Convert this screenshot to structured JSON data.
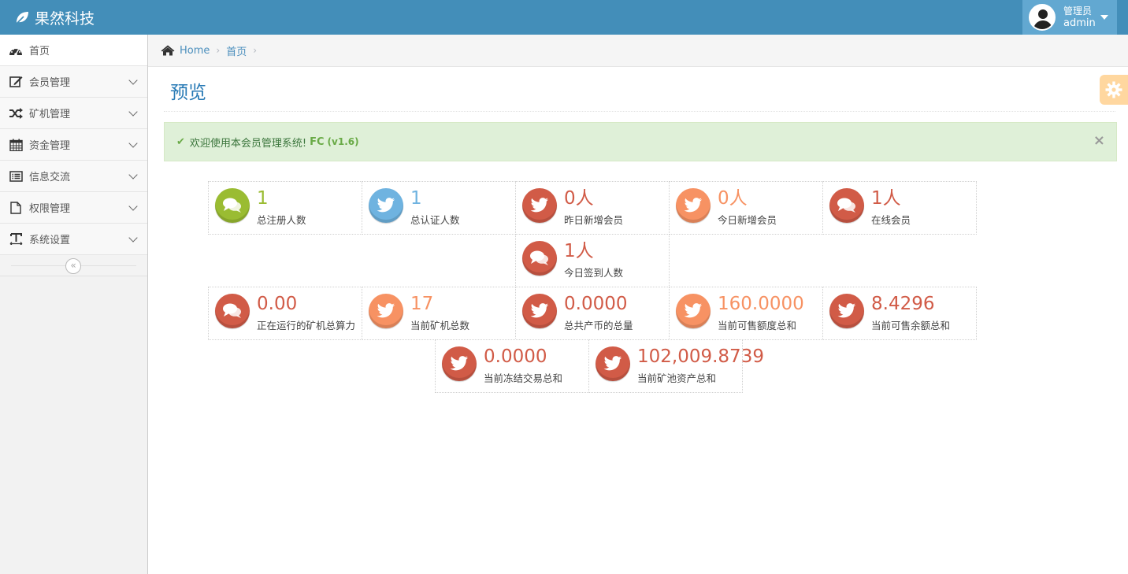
{
  "app": {
    "title": "果然科技"
  },
  "user": {
    "role": "管理员",
    "name": "admin"
  },
  "sidebar": {
    "items": [
      {
        "label": "首页",
        "icon": "dashboard-icon"
      },
      {
        "label": "会员管理",
        "icon": "edit-icon"
      },
      {
        "label": "矿机管理",
        "icon": "shuffle-icon"
      },
      {
        "label": "资金管理",
        "icon": "calendar-icon"
      },
      {
        "label": "信息交流",
        "icon": "list-alt-icon"
      },
      {
        "label": "权限管理",
        "icon": "file-icon"
      },
      {
        "label": "系统设置",
        "icon": "text-width-icon"
      }
    ],
    "collapse_glyph": "«"
  },
  "breadcrumb": {
    "home": "Home",
    "current": "首页",
    "sep": "›"
  },
  "page": {
    "title": "预览"
  },
  "alert": {
    "check": "✔",
    "text": "欢迎使用本会员管理系统!",
    "brand": "FC",
    "version": "(v1.6)",
    "close": "×"
  },
  "colors": {
    "navbar": "#438eb9",
    "green": "#9abc32",
    "blue": "#6fb3e0",
    "red": "#d15b47",
    "orange": "#f79263"
  },
  "stats": [
    {
      "value": "1",
      "label": "总注册人数",
      "color": "green",
      "icon": "comments-icon"
    },
    {
      "value": "1",
      "label": "总认证人数",
      "color": "blue",
      "icon": "twitter-icon"
    },
    {
      "value": "0人",
      "label": "昨日新增会员",
      "color": "red",
      "icon": "twitter-icon"
    },
    {
      "value": "0人",
      "label": "今日新增会员",
      "color": "orange",
      "icon": "twitter-icon"
    },
    {
      "value": "1人",
      "label": "在线会员",
      "color": "red",
      "icon": "comments-icon"
    },
    {
      "value": "1人",
      "label": "今日签到人数",
      "color": "red",
      "icon": "comments-icon"
    },
    {
      "value": "0.00",
      "label": "正在运行的矿机总算力",
      "color": "red",
      "icon": "comments-icon"
    },
    {
      "value": "17",
      "label": "当前矿机总数",
      "color": "orange",
      "icon": "twitter-icon"
    },
    {
      "value": "0.0000",
      "label": "总共产币的总量",
      "color": "red",
      "icon": "twitter-icon"
    },
    {
      "value": "160.0000",
      "label": "当前可售额度总和",
      "color": "orange",
      "icon": "twitter-icon"
    },
    {
      "value": "8.4296",
      "label": "当前可售余额总和",
      "color": "red",
      "icon": "twitter-icon"
    },
    {
      "value": "0.0000",
      "label": "当前冻结交易总和",
      "color": "red",
      "icon": "twitter-icon"
    },
    {
      "value": "102,009.8739",
      "label": "当前矿池资产总和",
      "color": "red",
      "icon": "twitter-icon"
    }
  ]
}
